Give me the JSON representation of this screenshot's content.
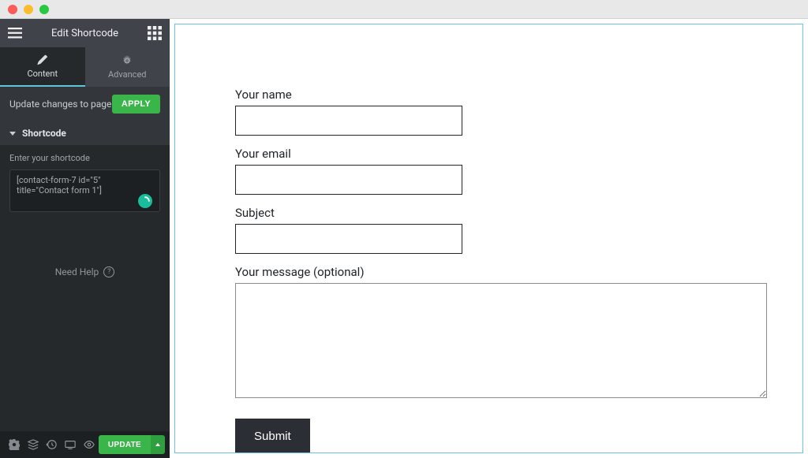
{
  "header": {
    "title": "Edit Shortcode"
  },
  "tabs": {
    "content": "Content",
    "advanced": "Advanced"
  },
  "update_row": {
    "label": "Update changes to page",
    "apply": "APPLY"
  },
  "section": {
    "title": "Shortcode"
  },
  "shortcode": {
    "label": "Enter your shortcode",
    "value": "[contact-form-7 id=\"5\" title=\"Contact form 1\"]"
  },
  "need_help": "Need Help",
  "bottom": {
    "update": "UPDATE"
  },
  "form": {
    "name_label": "Your name",
    "email_label": "Your email",
    "subject_label": "Subject",
    "message_label": "Your message (optional)",
    "submit": "Submit"
  }
}
